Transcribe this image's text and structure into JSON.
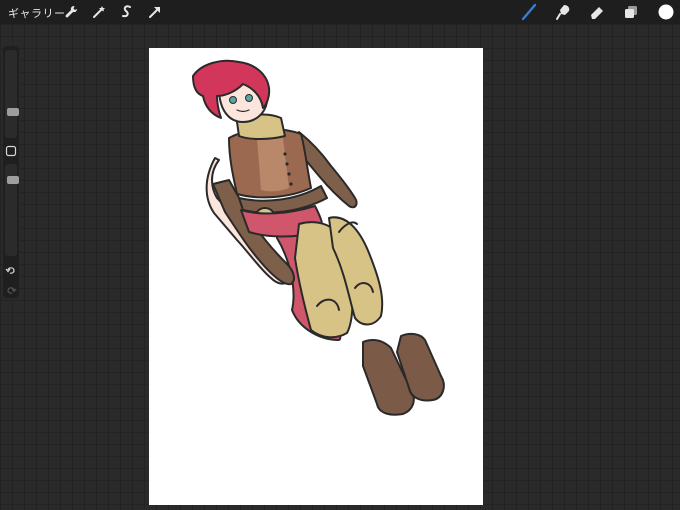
{
  "toolbar": {
    "gallery_label": "ギャラリー",
    "left_tools": [
      "wrench-icon",
      "magic-wand-icon",
      "selection-icon",
      "arrow-icon"
    ],
    "right_tools": [
      "brush-icon",
      "smudge-icon",
      "eraser-icon",
      "layers-icon",
      "color-icon"
    ],
    "active_tool": "brush-icon",
    "active_color": "#ffffff",
    "accent_color": "#3a7bd5"
  },
  "sidebar": {
    "brush_size": 0.72,
    "brush_opacity": 0.14,
    "buttons": [
      "modify-button",
      "undo-icon",
      "redo-icon"
    ]
  },
  "canvas": {
    "background": "#ffffff",
    "palette": {
      "hair": "#d2365a",
      "skin": "#fbe5dc",
      "vest": "#9b6950",
      "gloves": "#7d5f4a",
      "skirt": "#d0566b",
      "armor": "#d8c387",
      "boots": "#7b5b48",
      "outline": "#2a2a2a"
    }
  }
}
